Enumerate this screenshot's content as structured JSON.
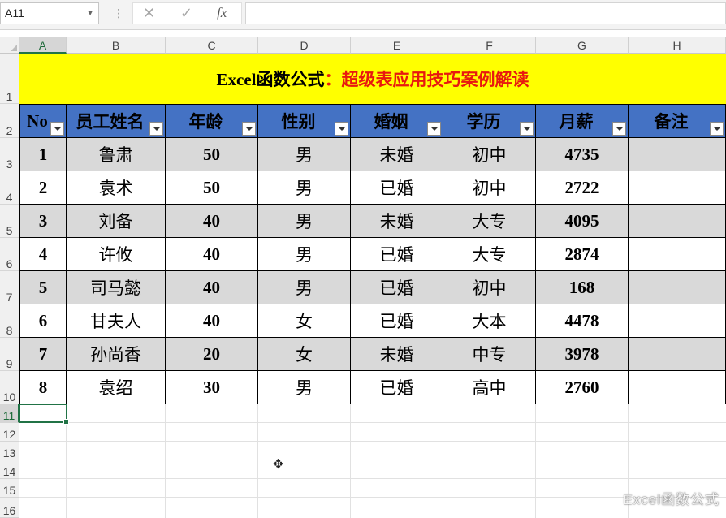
{
  "formula_bar": {
    "name_box": "A11",
    "cancel_icon": "✕",
    "enter_icon": "✓",
    "fx_label": "fx",
    "formula_value": ""
  },
  "columns": [
    "A",
    "B",
    "C",
    "D",
    "E",
    "F",
    "G",
    "H"
  ],
  "rows": [
    "1",
    "2",
    "3",
    "4",
    "5",
    "6",
    "7",
    "8",
    "9",
    "10",
    "11",
    "12",
    "13",
    "14",
    "15",
    "16"
  ],
  "title": {
    "part1": "Excel函数公式",
    "part2": "：超级表应用技巧案例解读"
  },
  "headers": [
    "No",
    "员工姓名",
    "年龄",
    "性别",
    "婚姻",
    "学历",
    "月薪",
    "备注"
  ],
  "table": [
    [
      "1",
      "鲁肃",
      "50",
      "男",
      "未婚",
      "初中",
      "4735",
      ""
    ],
    [
      "2",
      "袁术",
      "50",
      "男",
      "已婚",
      "初中",
      "2722",
      ""
    ],
    [
      "3",
      "刘备",
      "40",
      "男",
      "未婚",
      "大专",
      "4095",
      ""
    ],
    [
      "4",
      "许攸",
      "40",
      "男",
      "已婚",
      "大专",
      "2874",
      ""
    ],
    [
      "5",
      "司马懿",
      "40",
      "男",
      "已婚",
      "初中",
      "168",
      ""
    ],
    [
      "6",
      "甘夫人",
      "40",
      "女",
      "已婚",
      "大本",
      "4478",
      ""
    ],
    [
      "7",
      "孙尚香",
      "20",
      "女",
      "未婚",
      "中专",
      "3978",
      ""
    ],
    [
      "8",
      "袁绍",
      "30",
      "男",
      "已婚",
      "高中",
      "2760",
      ""
    ]
  ],
  "colors": {
    "title_bg": "#ffff00",
    "header_bg": "#4472c4",
    "band_bg": "#d9d9d9",
    "title_accent": "#e8190f",
    "selection": "#217346"
  },
  "watermark": "Excel函数公式"
}
